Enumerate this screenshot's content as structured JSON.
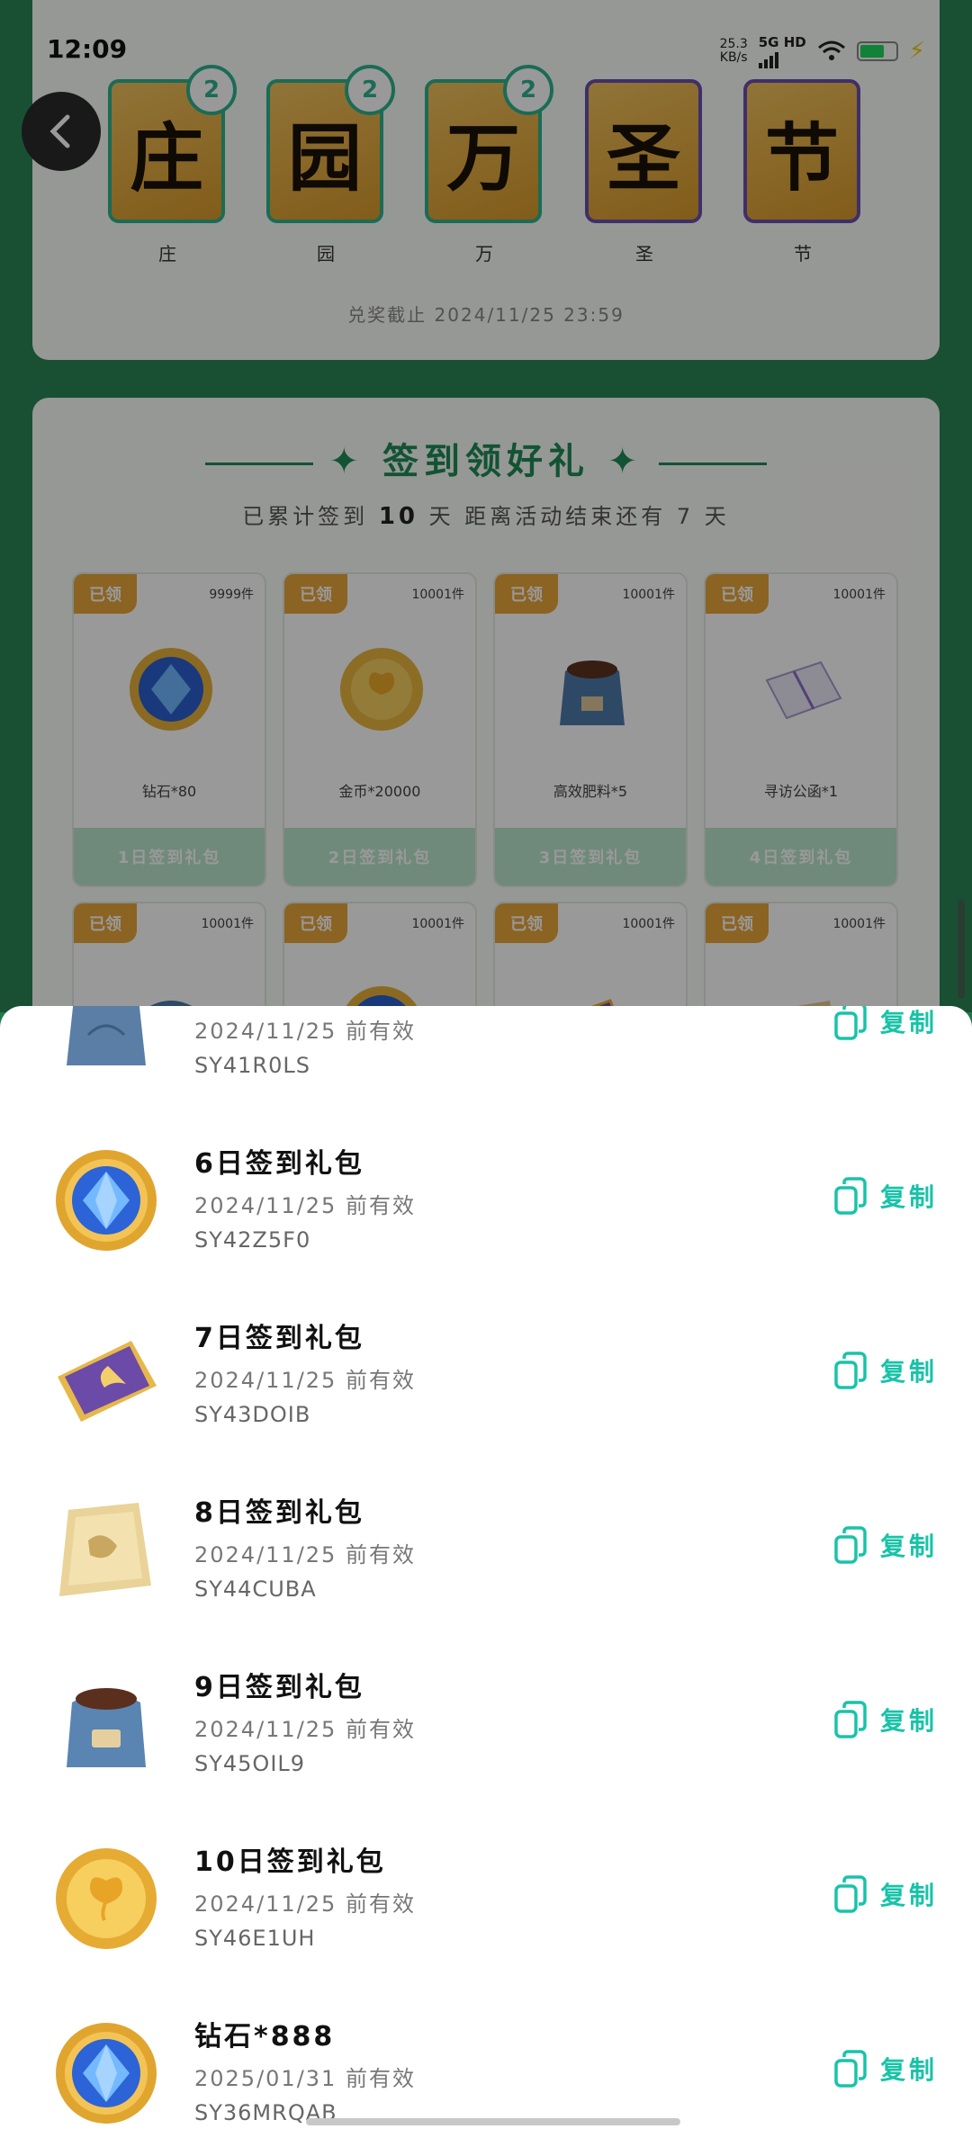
{
  "status_bar": {
    "time": "12:09",
    "net_speed": "25.3",
    "net_unit": "KB/s",
    "network": "5G HD"
  },
  "collect": {
    "cards": [
      {
        "char": "庄",
        "count": "2",
        "label": "庄"
      },
      {
        "char": "园",
        "count": "2",
        "label": "园"
      },
      {
        "char": "万",
        "count": "2",
        "label": "万"
      },
      {
        "char": "圣",
        "count": "",
        "label": "圣"
      },
      {
        "char": "节",
        "count": "",
        "label": "节"
      }
    ],
    "deadline": "兑奖截止 2024/11/25 23:59"
  },
  "signin": {
    "title": "签到领好礼",
    "sub_prefix": "已累计签到",
    "days": "10",
    "sub_suffix": "天  距离活动结束还有 7 天",
    "rewards": [
      {
        "tag": "已领",
        "stock": "9999件",
        "name": "钻石*80",
        "button": "1日签到礼包"
      },
      {
        "tag": "已领",
        "stock": "10001件",
        "name": "金币*20000",
        "button": "2日签到礼包"
      },
      {
        "tag": "已领",
        "stock": "10001件",
        "name": "高效肥料*5",
        "button": "3日签到礼包"
      },
      {
        "tag": "已领",
        "stock": "10001件",
        "name": "寻访公函*1",
        "button": "4日签到礼包"
      }
    ],
    "rewards_row2": [
      {
        "tag": "已领",
        "stock": "10001件"
      },
      {
        "tag": "已领",
        "stock": "10001件"
      },
      {
        "tag": "已领",
        "stock": "10001件"
      },
      {
        "tag": "已领",
        "stock": "10001件"
      }
    ]
  },
  "sheet": {
    "copy_label": "复制",
    "items": [
      {
        "title": "",
        "valid": "2024/11/25 前有效",
        "code": "SY41R0LS",
        "icon": "bag-icon"
      },
      {
        "title": "6日签到礼包",
        "valid": "2024/11/25 前有效",
        "code": "SY42Z5F0",
        "icon": "diamond-icon"
      },
      {
        "title": "7日签到礼包",
        "valid": "2024/11/25 前有效",
        "code": "SY43DOIB",
        "icon": "card-icon"
      },
      {
        "title": "8日签到礼包",
        "valid": "2024/11/25 前有效",
        "code": "SY44CUBA",
        "icon": "scroll-icon"
      },
      {
        "title": "9日签到礼包",
        "valid": "2024/11/25 前有效",
        "code": "SY45OIL9",
        "icon": "fertilizer-bag-icon"
      },
      {
        "title": "10日签到礼包",
        "valid": "2024/11/25 前有效",
        "code": "SY46E1UH",
        "icon": "coin-icon"
      },
      {
        "title": "钻石*888",
        "valid": "2025/01/31 前有效",
        "code": "SY36MRQAB",
        "icon": "diamond-icon"
      }
    ]
  }
}
